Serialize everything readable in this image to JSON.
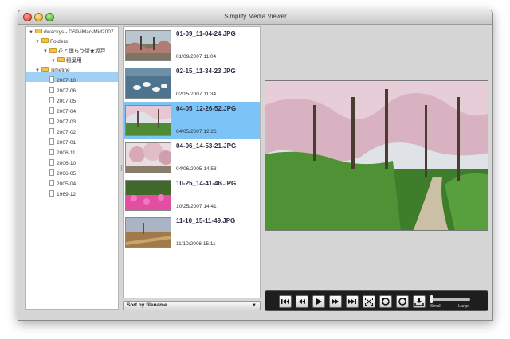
{
  "window": {
    "title": "Simplify Media Viewer"
  },
  "tree": {
    "root": "dwackys - DS9-iMac-Mid2007",
    "folders_label": "Folders",
    "subfolder": "花と踊らう街★坂戸",
    "selected_folder": "稲葉用",
    "timeline_label": "Timeline",
    "timeline_items": [
      "2007-10",
      "2007-06",
      "2007-05",
      "2007-04",
      "2007-03",
      "2007-02",
      "2007-01",
      "2006-11",
      "2006-10",
      "2006-05",
      "2005-04",
      "1969-12"
    ]
  },
  "files": [
    {
      "name": "01-09_11-04-24.JPG",
      "date": "01/09/2007 11:04",
      "selected": false
    },
    {
      "name": "02-15_11-34-23.JPG",
      "date": "02/15/2007 11:34",
      "selected": false
    },
    {
      "name": "04-05_12-26-52.JPG",
      "date": "04/05/2007 12:26",
      "selected": true
    },
    {
      "name": "04-06_14-53-21.JPG",
      "date": "04/06/2005 14:53",
      "selected": false
    },
    {
      "name": "10-25_14-41-46.JPG",
      "date": "10/25/2007 14:41",
      "selected": false
    },
    {
      "name": "11-10_15-11-49.JPG",
      "date": "11/10/2006 15:11",
      "selected": false
    }
  ],
  "sort": {
    "label": "Sort by filename"
  },
  "controls": {
    "small_label": "Small",
    "large_label": "Large",
    "zoom_level": 0
  },
  "colors": {
    "selection": "#7cc4f7",
    "tree_selection": "#9fd0f6",
    "controls_bg": "#1e1e1e"
  }
}
